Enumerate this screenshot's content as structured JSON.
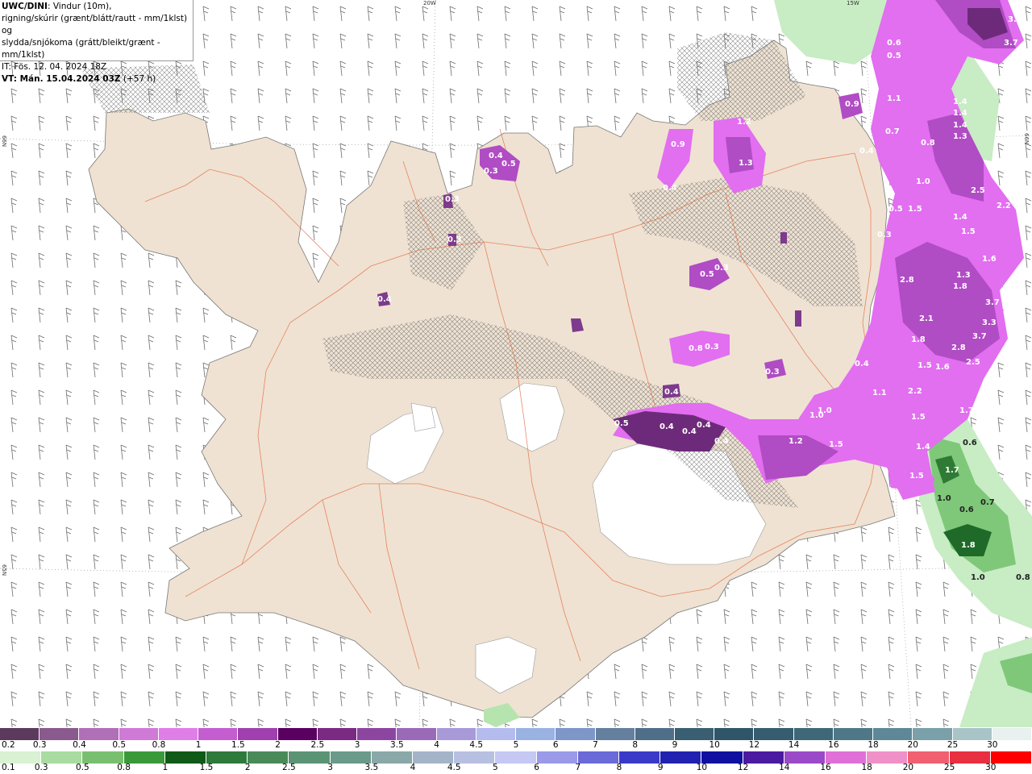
{
  "info": {
    "model": "UWC/DINI",
    "line1_rest": ": Vindur (10m),",
    "line2": "rigning/skúrir (grænt/blátt/rautt - mm/1klst) og",
    "line3": "slydda/snjókoma (grátt/bleikt/grænt - mm/1klst)",
    "it": "IT: Fös. 12. 04. 2024 18Z",
    "vt_bold": "VT: Mán. 15.04.2024 03Z",
    "vt_rest": " (+57 h)"
  },
  "grid_labels": {
    "lon20": "20W",
    "lon15": "15W",
    "lat66_left": "66N",
    "lat66_right": "66N",
    "lat65_left": "65N"
  },
  "map_values": {
    "purple": [
      "3.4",
      "3.7",
      "0.6",
      "0.5",
      "1.1",
      "1.4",
      "1.4",
      "1.4",
      "1.3",
      "0.9",
      "0.7",
      "0.8",
      "1.2",
      "0.9",
      "1.3",
      "0.4",
      "0.4",
      "0.5",
      "0.3",
      "0.5",
      "0.3",
      "0.3",
      "0.3",
      "0.4",
      "0.4",
      "1.0",
      "2.5",
      "2.2",
      "0.5",
      "1.5",
      "1.4",
      "0.3",
      "1.5",
      "1.6",
      "1.3",
      "1.8",
      "2.8",
      "3.7",
      "2.1",
      "3.3",
      "3.7",
      "1.8",
      "2.8",
      "2.5",
      "1.5",
      "1.6",
      "2.2",
      "1.1",
      "1.5",
      "1.0",
      "0.5",
      "0.4",
      "0.4",
      "0.4",
      "0.4",
      "0.8",
      "0.3",
      "0.3",
      "0.4",
      "1.2",
      "1.0",
      "1.5",
      "1.7",
      "1.4",
      "1.5",
      "0.4"
    ],
    "green": [
      "0.6",
      "1.7",
      "1.0",
      "0.6",
      "0.7",
      "1.8",
      "1.0",
      "0.8"
    ]
  },
  "legend_snow": {
    "labels": [
      "0.2",
      "0.3",
      "0.4",
      "0.5",
      "0.8",
      "1",
      "1.5",
      "2",
      "2.5",
      "3",
      "3.5",
      "4",
      "4.5",
      "5",
      "6",
      "7",
      "8",
      "9",
      "10",
      "12",
      "14",
      "16",
      "18",
      "20",
      "25",
      "30"
    ],
    "colors": [
      "#5b3a5d",
      "#8a5a8e",
      "#b06fb7",
      "#d07ad8",
      "#e07ee8",
      "#c45ed0",
      "#a040b0",
      "#5a0060",
      "#7a2a82",
      "#8c46a0",
      "#9a6ab8",
      "#a89ad8",
      "#b4bcee",
      "#9ab2e2",
      "#7e96c8",
      "#64809e",
      "#4e6e8a",
      "#3a5e72",
      "#2e5668",
      "#365c70",
      "#3e6878",
      "#4e7888",
      "#5e8898",
      "#7aa0aa",
      "#a8c4c6",
      "#e8f0f0"
    ]
  },
  "legend_rain": {
    "labels": [
      "0.1",
      "0.3",
      "0.5",
      "0.8",
      "1",
      "1.5",
      "2",
      "2.5",
      "3",
      "3.5",
      "4",
      "4.5",
      "5",
      "6",
      "7",
      "8",
      "9",
      "10",
      "12",
      "14",
      "16",
      "18",
      "20",
      "25",
      "30"
    ],
    "colors": [
      "#d8f2d2",
      "#a8dca0",
      "#78c070",
      "#3a9a3a",
      "#0e5a16",
      "#2e7a3a",
      "#4a8a58",
      "#5a9474",
      "#6a9a8a",
      "#8aa8a8",
      "#a4b4c8",
      "#b8c0e2",
      "#c4c8f2",
      "#9a9ae8",
      "#6a6ad8",
      "#3a3ac8",
      "#2222b0",
      "#1010a0",
      "#4a1aa0",
      "#9a4ac8",
      "#e070d8",
      "#f090c8",
      "#f06070",
      "#e83040",
      "#ff0000"
    ]
  },
  "colors": {
    "land": "#efe2d2",
    "snow_light": "#e26ef0",
    "snow_mid": "#b04cc4",
    "snow_dark": "#6e2a7a",
    "rain_light": "#c8ecc4",
    "rain_mid": "#5fb05a",
    "rain_dark": "#1f6a28",
    "roads": "#e4643a"
  }
}
